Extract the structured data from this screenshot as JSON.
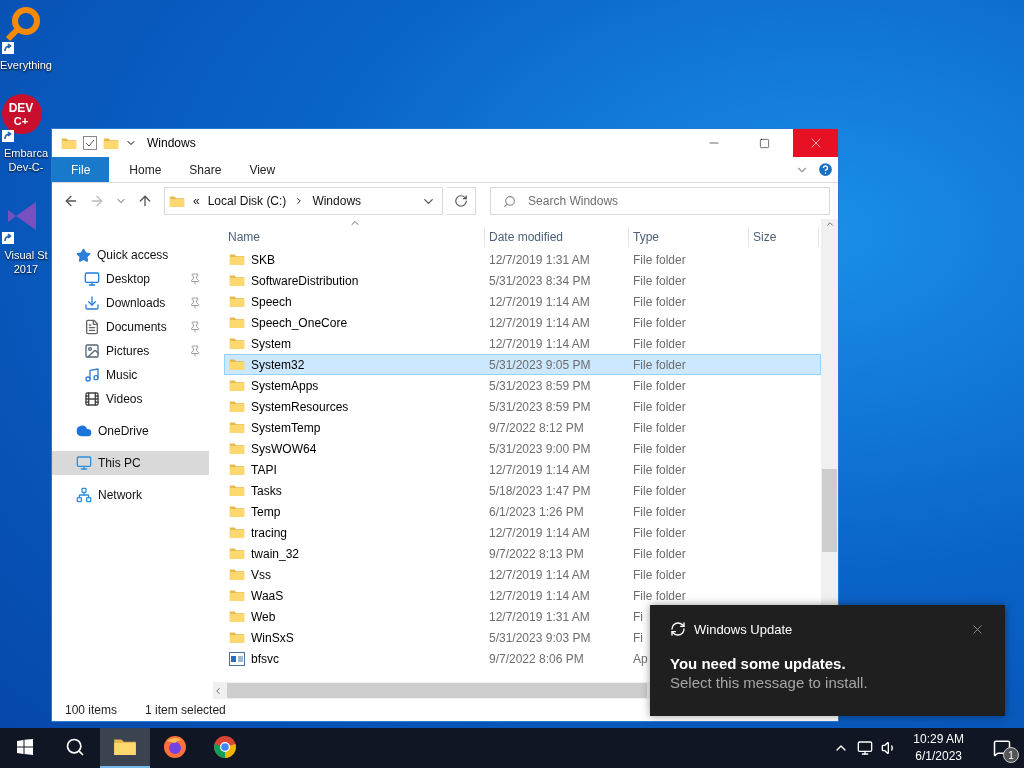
{
  "desktop_icons": [
    {
      "lines": [
        "Everything"
      ]
    },
    {
      "lines": [
        "Embarca",
        "Dev-C-"
      ],
      "logo_text": [
        "DEV",
        "C+"
      ]
    },
    {
      "lines": [
        "Visual St",
        "2017"
      ]
    }
  ],
  "window": {
    "title": "Windows",
    "ribbon_tabs": [
      {
        "label": "File",
        "kind": "file"
      },
      {
        "label": "Home",
        "kind": "tab"
      },
      {
        "label": "Share",
        "kind": "tab"
      },
      {
        "label": "View",
        "kind": "tab"
      }
    ],
    "address": {
      "overflow": "«",
      "crumbs": [
        "Local Disk (C:)",
        "Windows"
      ]
    },
    "search": {
      "placeholder": "Search Windows"
    },
    "nav": [
      {
        "label": "Quick access",
        "selected": false,
        "children": [
          {
            "label": "Desktop",
            "pinned": true
          },
          {
            "label": "Downloads",
            "pinned": true
          },
          {
            "label": "Documents",
            "pinned": true
          },
          {
            "label": "Pictures",
            "pinned": true
          },
          {
            "label": "Music",
            "pinned": false
          },
          {
            "label": "Videos",
            "pinned": false
          }
        ]
      },
      {
        "label": "OneDrive",
        "selected": false
      },
      {
        "label": "This PC",
        "selected": true
      },
      {
        "label": "Network",
        "selected": false
      }
    ],
    "columns": [
      {
        "label": "Name",
        "sorted": true
      },
      {
        "label": "Date modified",
        "sorted": false
      },
      {
        "label": "Type",
        "sorted": false
      },
      {
        "label": "Size",
        "sorted": false
      }
    ],
    "rows": [
      {
        "name": "SKB",
        "date": "12/7/2019 1:31 AM",
        "type": "File folder",
        "kind": "folder",
        "selected": false
      },
      {
        "name": "SoftwareDistribution",
        "date": "5/31/2023 8:34 PM",
        "type": "File folder",
        "kind": "folder",
        "selected": false
      },
      {
        "name": "Speech",
        "date": "12/7/2019 1:14 AM",
        "type": "File folder",
        "kind": "folder",
        "selected": false
      },
      {
        "name": "Speech_OneCore",
        "date": "12/7/2019 1:14 AM",
        "type": "File folder",
        "kind": "folder",
        "selected": false
      },
      {
        "name": "System",
        "date": "12/7/2019 1:14 AM",
        "type": "File folder",
        "kind": "folder",
        "selected": false
      },
      {
        "name": "System32",
        "date": "5/31/2023 9:05 PM",
        "type": "File folder",
        "kind": "folder",
        "selected": true
      },
      {
        "name": "SystemApps",
        "date": "5/31/2023 8:59 PM",
        "type": "File folder",
        "kind": "folder",
        "selected": false
      },
      {
        "name": "SystemResources",
        "date": "5/31/2023 8:59 PM",
        "type": "File folder",
        "kind": "folder",
        "selected": false
      },
      {
        "name": "SystemTemp",
        "date": "9/7/2022 8:12 PM",
        "type": "File folder",
        "kind": "folder",
        "selected": false
      },
      {
        "name": "SysWOW64",
        "date": "5/31/2023 9:00 PM",
        "type": "File folder",
        "kind": "folder",
        "selected": false
      },
      {
        "name": "TAPI",
        "date": "12/7/2019 1:14 AM",
        "type": "File folder",
        "kind": "folder",
        "selected": false
      },
      {
        "name": "Tasks",
        "date": "5/18/2023 1:47 PM",
        "type": "File folder",
        "kind": "folder",
        "selected": false
      },
      {
        "name": "Temp",
        "date": "6/1/2023 1:26 PM",
        "type": "File folder",
        "kind": "folder",
        "selected": false
      },
      {
        "name": "tracing",
        "date": "12/7/2019 1:14 AM",
        "type": "File folder",
        "kind": "folder",
        "selected": false
      },
      {
        "name": "twain_32",
        "date": "9/7/2022 8:13 PM",
        "type": "File folder",
        "kind": "folder",
        "selected": false
      },
      {
        "name": "Vss",
        "date": "12/7/2019 1:14 AM",
        "type": "File folder",
        "kind": "folder",
        "selected": false
      },
      {
        "name": "WaaS",
        "date": "12/7/2019 1:14 AM",
        "type": "File folder",
        "kind": "folder",
        "selected": false
      },
      {
        "name": "Web",
        "date": "12/7/2019 1:31 AM",
        "type": "Fi",
        "kind": "folder",
        "selected": false
      },
      {
        "name": "WinSxS",
        "date": "5/31/2023 9:03 PM",
        "type": "Fi",
        "kind": "folder",
        "selected": false
      },
      {
        "name": "bfsvc",
        "date": "9/7/2022 8:06 PM",
        "type": "Ap",
        "kind": "app",
        "selected": false
      }
    ],
    "status": [
      "100 items",
      "1 item selected"
    ]
  },
  "toast": {
    "app": "Windows Update",
    "title": "You need some updates.",
    "message": "Select this message to install."
  },
  "taskbar": {
    "apps": [
      {
        "active": false
      },
      {
        "active": true
      },
      {
        "active": false
      },
      {
        "active": false
      }
    ],
    "time": "10:29 AM",
    "date": "6/1/2023",
    "notifications": "1"
  }
}
